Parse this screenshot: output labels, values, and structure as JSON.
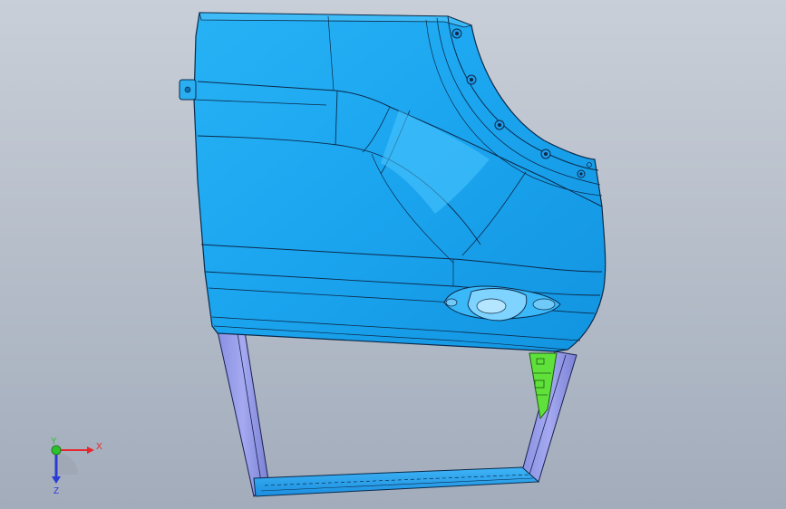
{
  "viewport": {
    "background_top": "#c9cfd8",
    "background_bottom": "#a2acbb"
  },
  "model": {
    "panel_color": "#1aa3ef",
    "panel_highlight": "#7fd3ff",
    "edge_color": "#0b2a4a",
    "frame_color": "#8f95e6",
    "frame_dark": "#5e64c0",
    "bracket_color": "#5fe03a",
    "handle_color": "#46c3ff"
  },
  "triad": {
    "x_label": "X",
    "y_label": "Y",
    "z_label": "Z",
    "x_color": "#e8262b",
    "y_color": "#2cc22c",
    "z_color": "#2b3cd6",
    "icon": "coordinate-triad-icon"
  }
}
